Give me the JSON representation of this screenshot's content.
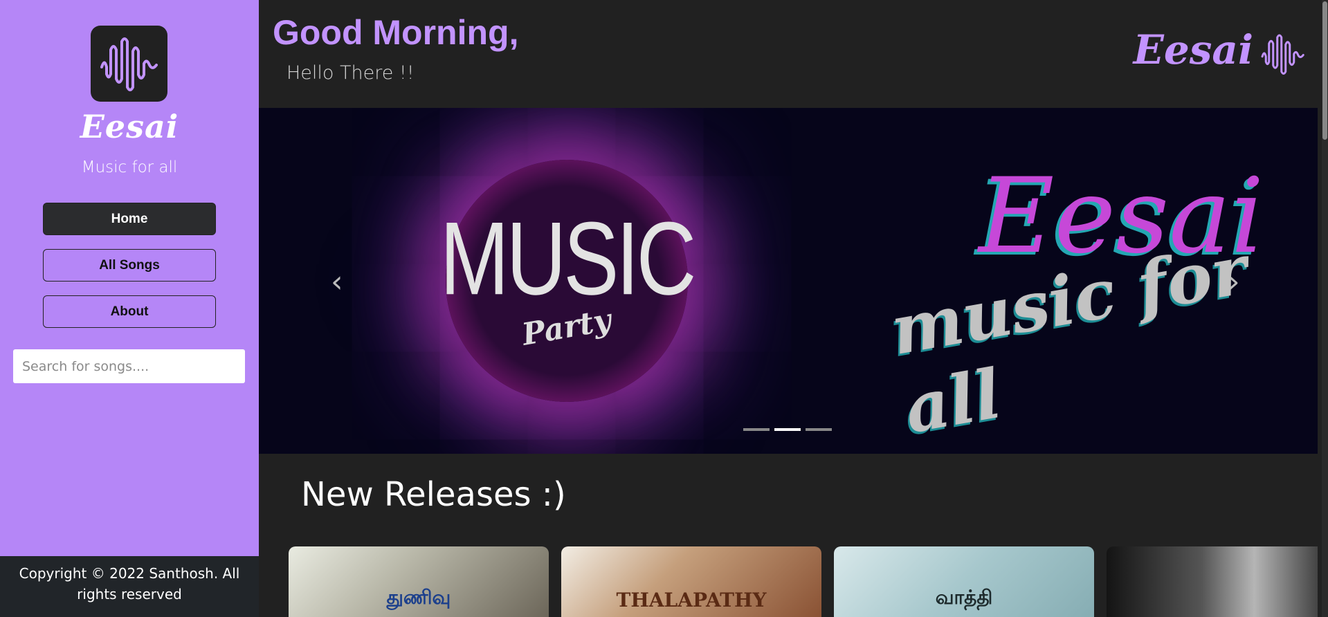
{
  "sidebar": {
    "brand": "Eesai",
    "tagline": "Music for all",
    "nav": [
      {
        "label": "Home"
      },
      {
        "label": "All Songs"
      },
      {
        "label": "About"
      }
    ],
    "search_placeholder": "Search for songs....",
    "footer": "Copyright © 2022 Santhosh. All rights reserved"
  },
  "header": {
    "greeting": "Good Morning,",
    "subgreeting": "Hello There !!",
    "brand": "Eesai"
  },
  "carousel": {
    "slide_title": "MUSIC",
    "slide_subtitle": "Party",
    "banner_brand": "Eesai",
    "banner_tagline": "music for all",
    "prev_icon": "‹",
    "next_icon": "›",
    "slides_count": 3,
    "active_index": 1
  },
  "releases": {
    "title": "New Releases :)",
    "cards": [
      {
        "label": "துணிவு"
      },
      {
        "label": "THALAPATHY"
      },
      {
        "label": "வாத்தி"
      },
      {
        "label": ""
      }
    ]
  },
  "colors": {
    "accent": "#b586f7",
    "accent_text": "#c293ff",
    "background": "#212121"
  }
}
